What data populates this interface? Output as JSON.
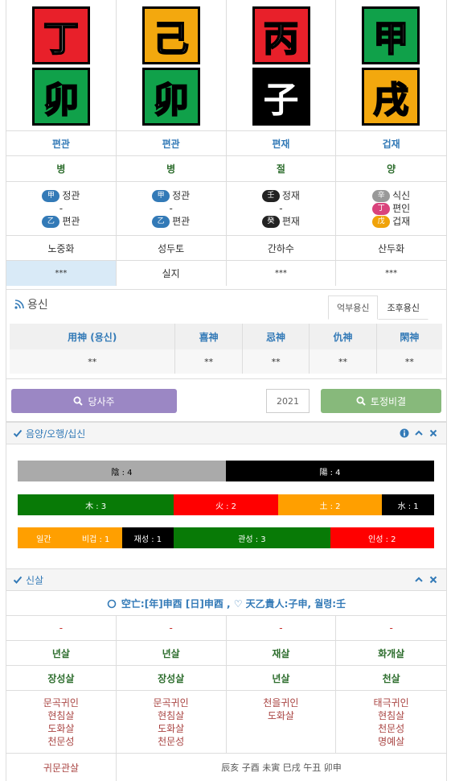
{
  "pillars": [
    {
      "stem": "丁",
      "stem_color": "#e8202a",
      "branch": "卯",
      "branch_color": "#10a14a"
    },
    {
      "stem": "己",
      "stem_color": "#f3a80e",
      "branch": "卯",
      "branch_color": "#10a14a"
    },
    {
      "stem": "丙",
      "stem_color": "#e8202a",
      "branch": "子",
      "branch_color": "#000000"
    },
    {
      "stem": "甲",
      "stem_color": "#10a14a",
      "branch": "戌",
      "branch_color": "#f3a80e"
    }
  ],
  "sipsin": [
    "편관",
    "편관",
    "편재",
    "겁재"
  ],
  "unseong": [
    "병",
    "병",
    "절",
    "양"
  ],
  "hidden": [
    {
      "rows": [
        {
          "pill": "甲",
          "color": "#337ab7",
          "text": "정관"
        },
        {
          "dash": "-"
        },
        {
          "pill": "乙",
          "color": "#337ab7",
          "text": "편관"
        }
      ]
    },
    {
      "rows": [
        {
          "pill": "甲",
          "color": "#337ab7",
          "text": "정관"
        },
        {
          "dash": "-"
        },
        {
          "pill": "乙",
          "color": "#337ab7",
          "text": "편관"
        }
      ]
    },
    {
      "rows": [
        {
          "pill": "壬",
          "color": "#222222",
          "text": "정재"
        },
        {
          "dash": "-"
        },
        {
          "pill": "癸",
          "color": "#222222",
          "text": "편재"
        }
      ]
    },
    {
      "rows": [
        {
          "pill": "辛",
          "color": "#999999",
          "text": "식신"
        },
        {
          "pill": "丁",
          "color": "#d9437c",
          "text": "편인"
        },
        {
          "pill": "戊",
          "color": "#f0a30a",
          "text": "겁재"
        }
      ]
    }
  ],
  "napeum": [
    "노중화",
    "성두토",
    "간하수",
    "산두화"
  ],
  "extra": [
    "***",
    "실지",
    "***",
    "***"
  ],
  "yongsin": {
    "title": "용신",
    "tabs": [
      "억부용신",
      "조후용신"
    ],
    "headers": [
      "用神 (용신)",
      "喜神",
      "忌神",
      "仇神",
      "閑神"
    ],
    "values": [
      "**",
      "**",
      "**",
      "**",
      "**"
    ]
  },
  "buttons": {
    "dangsaju": "당사주",
    "year": "2021",
    "tojeong": "토정비결"
  },
  "eumyang_title": "음양/오행/십신",
  "bars": {
    "yinyang": [
      {
        "label": "陰 : 4",
        "color": "#aaaaaa",
        "text_color": "#000000",
        "value": 4
      },
      {
        "label": "陽 : 4",
        "color": "#000000",
        "text_color": "#ffffff",
        "value": 4
      }
    ],
    "ohaeng": [
      {
        "label": "木 : 3",
        "color": "#087a06",
        "value": 3
      },
      {
        "label": "火 : 2",
        "color": "#ff0000",
        "value": 2
      },
      {
        "label": "土 : 2",
        "color": "#ff9f00",
        "value": 2
      },
      {
        "label": "水 : 1",
        "color": "#000000",
        "value": 1
      }
    ],
    "sipsin": [
      {
        "label": "일간",
        "color": "#ff9f00",
        "value": 1
      },
      {
        "label": "비겁 : 1",
        "color": "#ff9f00",
        "value": 1
      },
      {
        "label": "재성 : 1",
        "color": "#000000",
        "value": 1
      },
      {
        "label": "관성 : 3",
        "color": "#087a06",
        "value": 3
      },
      {
        "label": "인성 : 2",
        "color": "#ff0000",
        "value": 2
      }
    ]
  },
  "sinsal_title": "신살",
  "sinsal_header": "空亡:[年]申酉 [日]申酉 , ♡ 天乙貴人:子申, 월령:壬",
  "sinsal_row1": [
    "-",
    "-",
    "-",
    "-"
  ],
  "sinsal_row2": [
    "년살",
    "년살",
    "재살",
    "화개살"
  ],
  "sinsal_row3": [
    "장성살",
    "장성살",
    "년살",
    "천살"
  ],
  "sinsal_row4": [
    [
      "문곡귀인",
      "현침살",
      "도화살",
      "천문성"
    ],
    [
      "문곡귀인",
      "현침살",
      "도화살",
      "천문성"
    ],
    [
      "천을귀인",
      "도화살"
    ],
    [
      "태극귀인",
      "현침살",
      "천문성",
      "명예살"
    ]
  ],
  "guimun": {
    "label": "귀문관살",
    "value": "辰亥 子酉 未寅 巳戌 午丑 卯申"
  }
}
